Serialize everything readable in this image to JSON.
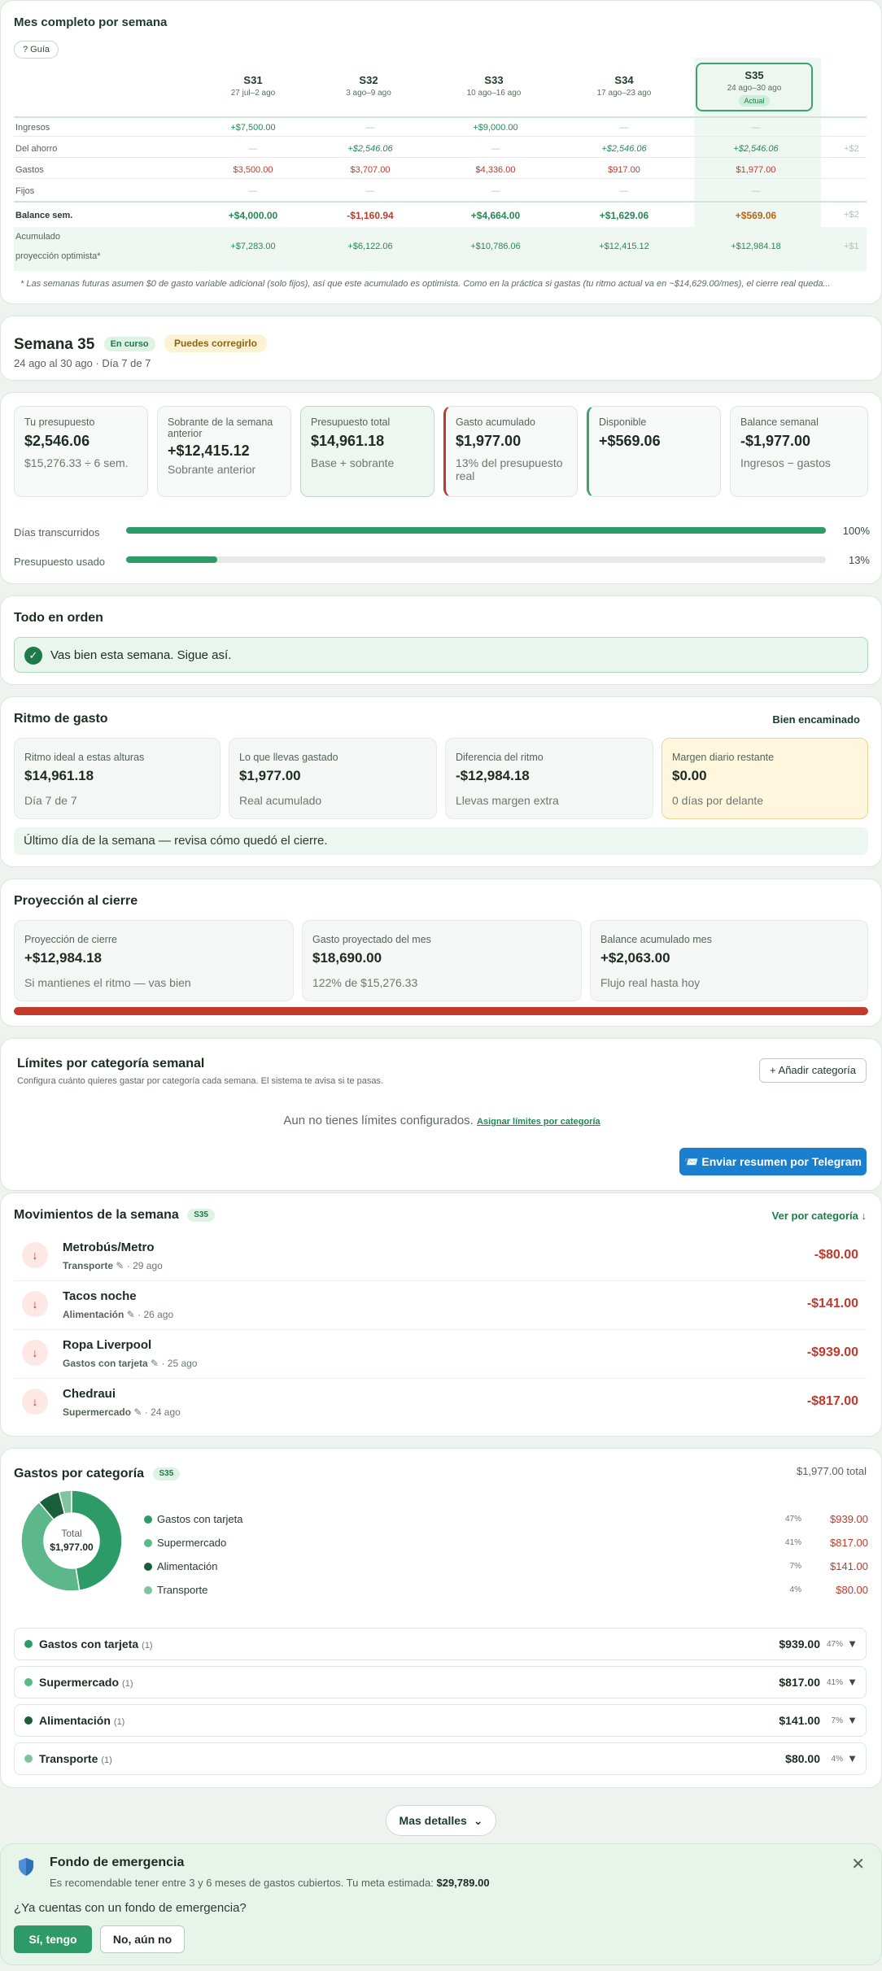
{
  "table": {
    "title": "Mes completo por semana",
    "guide_label": "? Guía",
    "weeks": [
      {
        "label": "S31",
        "range": "27 jul–2 ago"
      },
      {
        "label": "S32",
        "range": "3 ago–9 ago"
      },
      {
        "label": "S33",
        "range": "10 ago–16 ago"
      },
      {
        "label": "S34",
        "range": "17 ago–23 ago"
      },
      {
        "label": "S35",
        "range": "24 ago–30 ago",
        "badge": "Actual"
      }
    ],
    "rows": {
      "ingresos": {
        "label": "Ingresos",
        "values": [
          "+$7,500.00",
          "—",
          "+$9,000.00",
          "—",
          "—"
        ]
      },
      "ahorro": {
        "label": "Del ahorro",
        "values": [
          "—",
          "+$2,546.06",
          "—",
          "+$2,546.06",
          "+$2,546.06"
        ],
        "overflow": "+$2"
      },
      "gastos": {
        "label": "Gastos",
        "values": [
          "$3,500.00",
          "$3,707.00",
          "$4,336.00",
          "$917.00",
          "$1,977.00"
        ]
      },
      "fijos": {
        "label": "Fijos",
        "values": [
          "—",
          "—",
          "—",
          "—",
          "—"
        ]
      },
      "balance": {
        "label": "Balance sem.",
        "values": [
          "+$4,000.00",
          "-$1,160.94",
          "+$4,664.00",
          "+$1,629.06",
          "+$569.06"
        ],
        "overflow": "+$2"
      },
      "acumulado": {
        "label": "Acumulado",
        "sublabel": "proyección optimista*",
        "values": [
          "+$7,283.00",
          "+$6,122.06",
          "+$10,786.06",
          "+$12,415.12",
          "+$12,984.18"
        ],
        "overflow": "+$1"
      }
    },
    "footnote": "* Las semanas futuras asumen $0 de gasto variable adicional (solo fijos), así que este acumulado es optimista. Como en la práctica si gastas (tu ritmo actual va en ~$14,629.00/mes), el cierre real queda..."
  },
  "week": {
    "title": "Semana 35",
    "status_badge": "En curso",
    "fix_badge": "Puedes corregirlo",
    "subtitle": "24 ago al 30 ago · Día 7 de 7"
  },
  "summary": [
    {
      "label": "Tu presupuesto",
      "value": "$2,546.06",
      "sub": "$15,276.33 ÷ 6 sem."
    },
    {
      "label": "Sobrante de la semana anterior",
      "value": "+$12,415.12",
      "sub": "Sobrante anterior"
    },
    {
      "label": "Presupuesto total",
      "value": "$14,961.18",
      "sub": "Base + sobrante"
    },
    {
      "label": "Gasto acumulado",
      "value": "$1,977.00",
      "sub": "13% del presupuesto real"
    },
    {
      "label": "Disponible",
      "value": "+$569.06",
      "sub": ""
    },
    {
      "label": "Balance semanal",
      "value": "-$1,977.00",
      "sub": "Ingresos − gastos"
    }
  ],
  "progress": [
    {
      "label": "Días transcurridos",
      "pct_text": "100%",
      "fraction": 1.0
    },
    {
      "label": "Presupuesto usado",
      "pct_text": "13%",
      "fraction": 0.13
    }
  ],
  "status": {
    "title": "Todo en orden",
    "message": "Vas bien esta semana. Sigue así."
  },
  "pace": {
    "title": "Ritmo de gasto",
    "tag": "Bien encaminado",
    "boxes": [
      {
        "label": "Ritmo ideal a estas alturas",
        "value": "$14,961.18",
        "sub": "Día 7 de 7"
      },
      {
        "label": "Lo que llevas gastado",
        "value": "$1,977.00",
        "sub": "Real acumulado"
      },
      {
        "label": "Diferencia del ritmo",
        "value": "-$12,984.18",
        "sub": "Llevas margen extra"
      },
      {
        "label": "Margen diario restante",
        "value": "$0.00",
        "sub": "0 días por delante"
      }
    ],
    "note": "Último día de la semana — revisa cómo quedó el cierre."
  },
  "projection": {
    "title": "Proyección al cierre",
    "boxes": [
      {
        "label": "Proyección de cierre",
        "value": "+$12,984.18",
        "sub": "Si mantienes el ritmo — vas bien"
      },
      {
        "label": "Gasto proyectado del mes",
        "value": "$18,690.00",
        "sub": "122% de $15,276.33"
      },
      {
        "label": "Balance acumulado mes",
        "value": "+$2,063.00",
        "sub": "Flujo real hasta hoy"
      }
    ]
  },
  "limits": {
    "title": "Límites por categoría semanal",
    "subtitle": "Configura cuánto quieres gastar por categoría cada semana. El sistema te avisa si te pasas.",
    "add_label": "+ Añadir categoría",
    "empty_text": "Aun no tienes límites configurados.",
    "assign_link": "Asignar límites por categoría",
    "telegram_label": "📨 Enviar resumen por Telegram"
  },
  "movements": {
    "title": "Movimientos de la semana",
    "badge": "S35",
    "link": "Ver por categoría ↓",
    "items": [
      {
        "name": "Metrobús/Metro",
        "category": "Transporte",
        "date": "29 ago",
        "amount": "-$80.00"
      },
      {
        "name": "Tacos noche",
        "category": "Alimentación",
        "date": "26 ago",
        "amount": "-$141.00"
      },
      {
        "name": "Ropa Liverpool",
        "category": "Gastos con tarjeta",
        "date": "25 ago",
        "amount": "-$939.00"
      },
      {
        "name": "Chedraui",
        "category": "Supermercado",
        "date": "24 ago",
        "amount": "-$817.00"
      }
    ]
  },
  "categories": {
    "title": "Gastos por categoría",
    "badge": "S35",
    "total_text": "$1,977.00 total",
    "donut_label": "Total",
    "donut_value": "$1,977.00",
    "items": [
      {
        "name": "Gastos con tarjeta",
        "pct": "47%",
        "amount": "$939.00",
        "count": "(1)",
        "color": "#2e9a68",
        "value": 939
      },
      {
        "name": "Supermercado",
        "pct": "41%",
        "amount": "$817.00",
        "count": "(1)",
        "color": "#5cb88a",
        "value": 817
      },
      {
        "name": "Alimentación",
        "pct": "7%",
        "amount": "$141.00",
        "count": "(1)",
        "color": "#1a5e3c",
        "value": 141
      },
      {
        "name": "Transporte",
        "pct": "4%",
        "amount": "$80.00",
        "count": "(1)",
        "color": "#7fc49f",
        "value": 80
      }
    ]
  },
  "more_details": "Mas detalles",
  "emergency": {
    "title": "Fondo de emergencia",
    "subtitle": "Es recomendable tener entre 3 y 6 meses de gastos cubiertos. Tu meta estimada:",
    "goal": "$29,789.00",
    "question": "¿Ya cuentas con un fondo de emergencia?",
    "yes": "Sí, tengo",
    "no": "No, aún no"
  },
  "colors": {
    "accent": "#2e9a68",
    "negative": "#c0392b",
    "telegram": "#1a7fcf",
    "warning_bg": "#fef7de"
  }
}
